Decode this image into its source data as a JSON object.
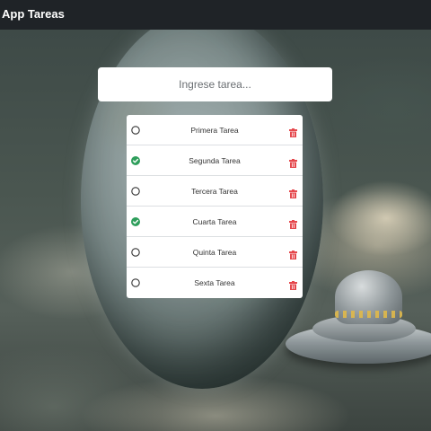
{
  "header": {
    "title": "App Tareas"
  },
  "input": {
    "placeholder": "Ingrese tarea...",
    "value": ""
  },
  "colors": {
    "done": "#2e9e5b",
    "pending": "#333333",
    "delete": "#e5484d",
    "topbar": "#1f2327"
  },
  "icons": {
    "pending": "circle-outline-icon",
    "done": "check-circle-icon",
    "delete": "trash-icon"
  },
  "tasks": [
    {
      "label": "Primera Tarea",
      "done": false
    },
    {
      "label": "Segunda Tarea",
      "done": true
    },
    {
      "label": "Tercera Tarea",
      "done": false
    },
    {
      "label": "Cuarta Tarea",
      "done": true
    },
    {
      "label": "Quinta Tarea",
      "done": false
    },
    {
      "label": "Sexta Tarea",
      "done": false
    }
  ]
}
